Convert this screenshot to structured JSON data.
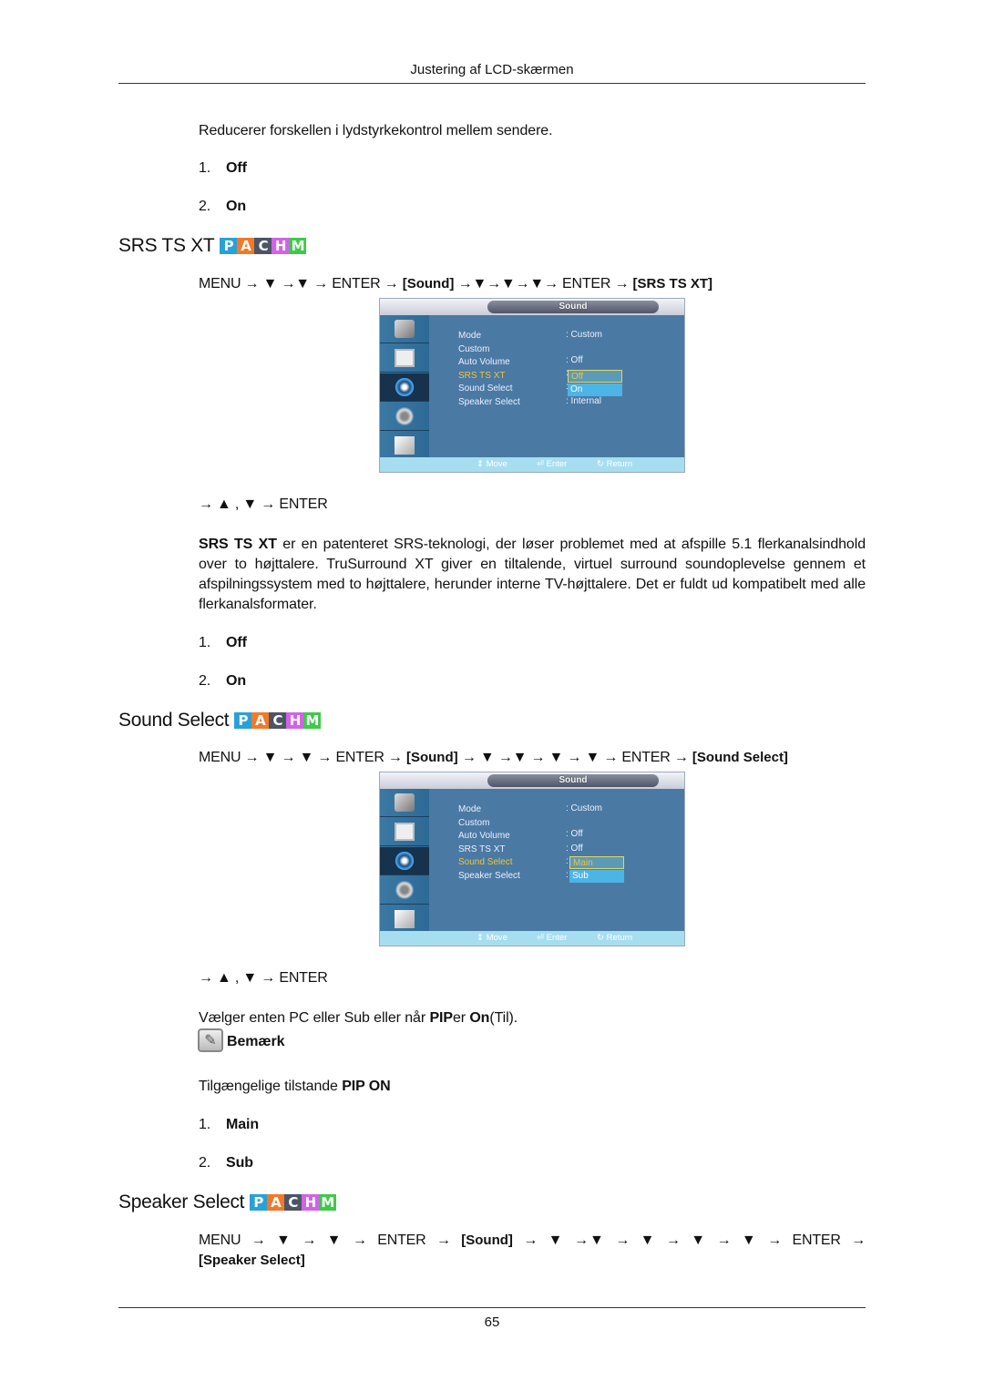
{
  "header": {
    "title": "Justering af LCD-skærmen"
  },
  "intro": {
    "text": "Reducerer forskellen i lydstyrkekontrol mellem sendere.",
    "options": [
      {
        "num": "1.",
        "label": "Off"
      },
      {
        "num": "2.",
        "label": "On"
      }
    ]
  },
  "badge": {
    "letters": [
      "P",
      "A",
      "C",
      "H",
      "M"
    ],
    "colors": [
      "#2aa1d6",
      "#f07a2a",
      "#4d5466",
      "#d163e6",
      "#3ec94a"
    ]
  },
  "sections": [
    {
      "title": "SRS TS XT",
      "path": {
        "prefix": "MENU → ▼ →▼ → ENTER →",
        "menu": "[Sound]",
        "middle": "→▼→▼→▼→ ENTER →",
        "target": "[SRS TS XT]"
      },
      "osd": {
        "title": "Sound",
        "menu_items": [
          "Mode",
          "Custom",
          "Auto Volume",
          "SRS TS XT",
          "Sound Select",
          "Speaker Select"
        ],
        "highlighted_index": 3,
        "values": [
          ": Custom",
          "",
          ": Off",
          ":",
          ":",
          ": Internal"
        ],
        "dropdown": {
          "current": "Off",
          "option": "On"
        },
        "footer": {
          "move": "Move",
          "enter": "Enter",
          "return": "Return"
        }
      },
      "nav_hint": "→ ▲ , ▼ → ENTER",
      "description_bold": "SRS TS XT",
      "description": " er en patenteret SRS-teknologi, der løser problemet med at afspille 5.1 flerka­nalsindhold over to højttalere. TruSurround XT giver en tiltalende, virtuel surround sound­oplevelse gennem et afspilningssystem med to højttalere, herunder interne TV-højttalere. Det er fuldt ud kompatibelt med alle flerkanalsformater.",
      "options": [
        {
          "num": "1.",
          "label": "Off"
        },
        {
          "num": "2.",
          "label": "On"
        }
      ]
    },
    {
      "title": "Sound Select",
      "path": {
        "prefix": "MENU → ▼ → ▼ → ENTER →",
        "menu": "[Sound]",
        "middle": "→ ▼ →▼ → ▼ → ▼ → ENTER →",
        "target": "[Sound Select]"
      },
      "osd": {
        "title": "Sound",
        "menu_items": [
          "Mode",
          "Custom",
          "Auto Volume",
          "SRS TS XT",
          "Sound Select",
          "Speaker Select"
        ],
        "highlighted_index": 4,
        "values": [
          ": Custom",
          "",
          ": Off",
          ": Off",
          ":",
          ":"
        ],
        "dropdown": {
          "current": "Main",
          "option": "Sub"
        },
        "footer": {
          "move": "Move",
          "enter": "Enter",
          "return": "Return"
        }
      },
      "nav_hint": "→ ▲ , ▼ → ENTER",
      "description": {
        "t1": "Vælger enten PC eller Sub eller når ",
        "b1": "PIP",
        "t2": "er ",
        "b2": "On",
        "t3": "(Til)."
      },
      "note": {
        "label": "Bemærk",
        "text": "Tilgængelige tilstande ",
        "text_bold": "PIP ON",
        "options": [
          {
            "num": "1.",
            "label": "Main"
          },
          {
            "num": "2.",
            "label": "Sub"
          }
        ]
      }
    },
    {
      "title": "Speaker Select",
      "path": {
        "prefix": "MENU → ▼ → ▼ → ENTER →",
        "menu": "[Sound]",
        "middle": "→ ▼ →▼ → ▼ → ▼ → ▼ → ENTER →",
        "target": "[Speaker Select]"
      }
    }
  ],
  "footer": {
    "page_number": "65"
  }
}
